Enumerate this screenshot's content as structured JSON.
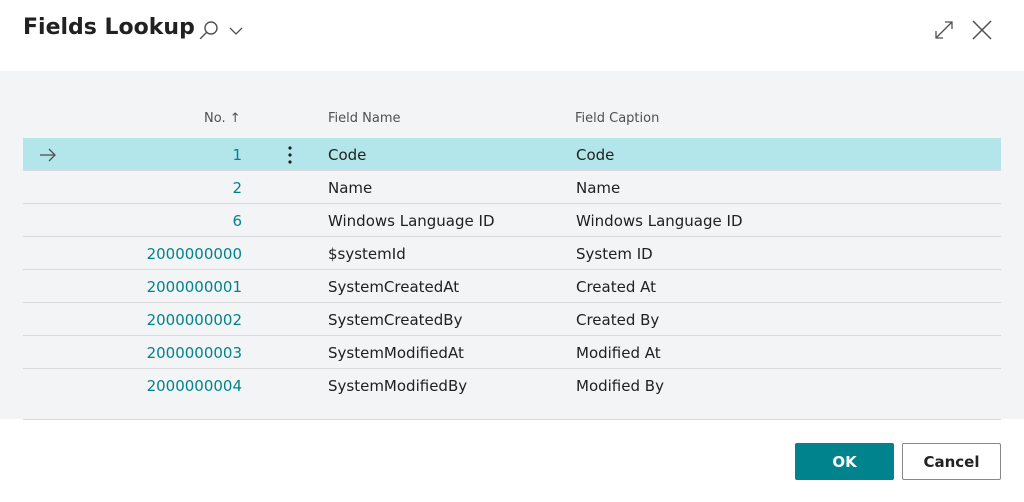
{
  "dialog": {
    "title": "Fields Lookup"
  },
  "columns": {
    "no": "No. ↑",
    "field_name": "Field Name",
    "field_caption": "Field Caption"
  },
  "rows": [
    {
      "no": "1",
      "field_name": "Code",
      "field_caption": "Code",
      "selected": true
    },
    {
      "no": "2",
      "field_name": "Name",
      "field_caption": "Name"
    },
    {
      "no": "6",
      "field_name": "Windows Language ID",
      "field_caption": "Windows Language ID"
    },
    {
      "no": "2000000000",
      "field_name": "$systemId",
      "field_caption": "System ID"
    },
    {
      "no": "2000000001",
      "field_name": "SystemCreatedAt",
      "field_caption": "Created At"
    },
    {
      "no": "2000000002",
      "field_name": "SystemCreatedBy",
      "field_caption": "Created By"
    },
    {
      "no": "2000000003",
      "field_name": "SystemModifiedAt",
      "field_caption": "Modified At"
    },
    {
      "no": "2000000004",
      "field_name": "SystemModifiedBy",
      "field_caption": "Modified By"
    }
  ],
  "buttons": {
    "ok": "OK",
    "cancel": "Cancel"
  },
  "icons": {
    "search": "search-icon",
    "dropdown": "chevron-down-icon",
    "expand": "expand-icon",
    "close": "close-icon",
    "row_arrow": "arrow-right-icon",
    "row_menu": "more-vertical-icon"
  },
  "colors": {
    "accent": "#00838c",
    "selected_row": "#b2e6eb",
    "panel": "#f3f4f5"
  }
}
